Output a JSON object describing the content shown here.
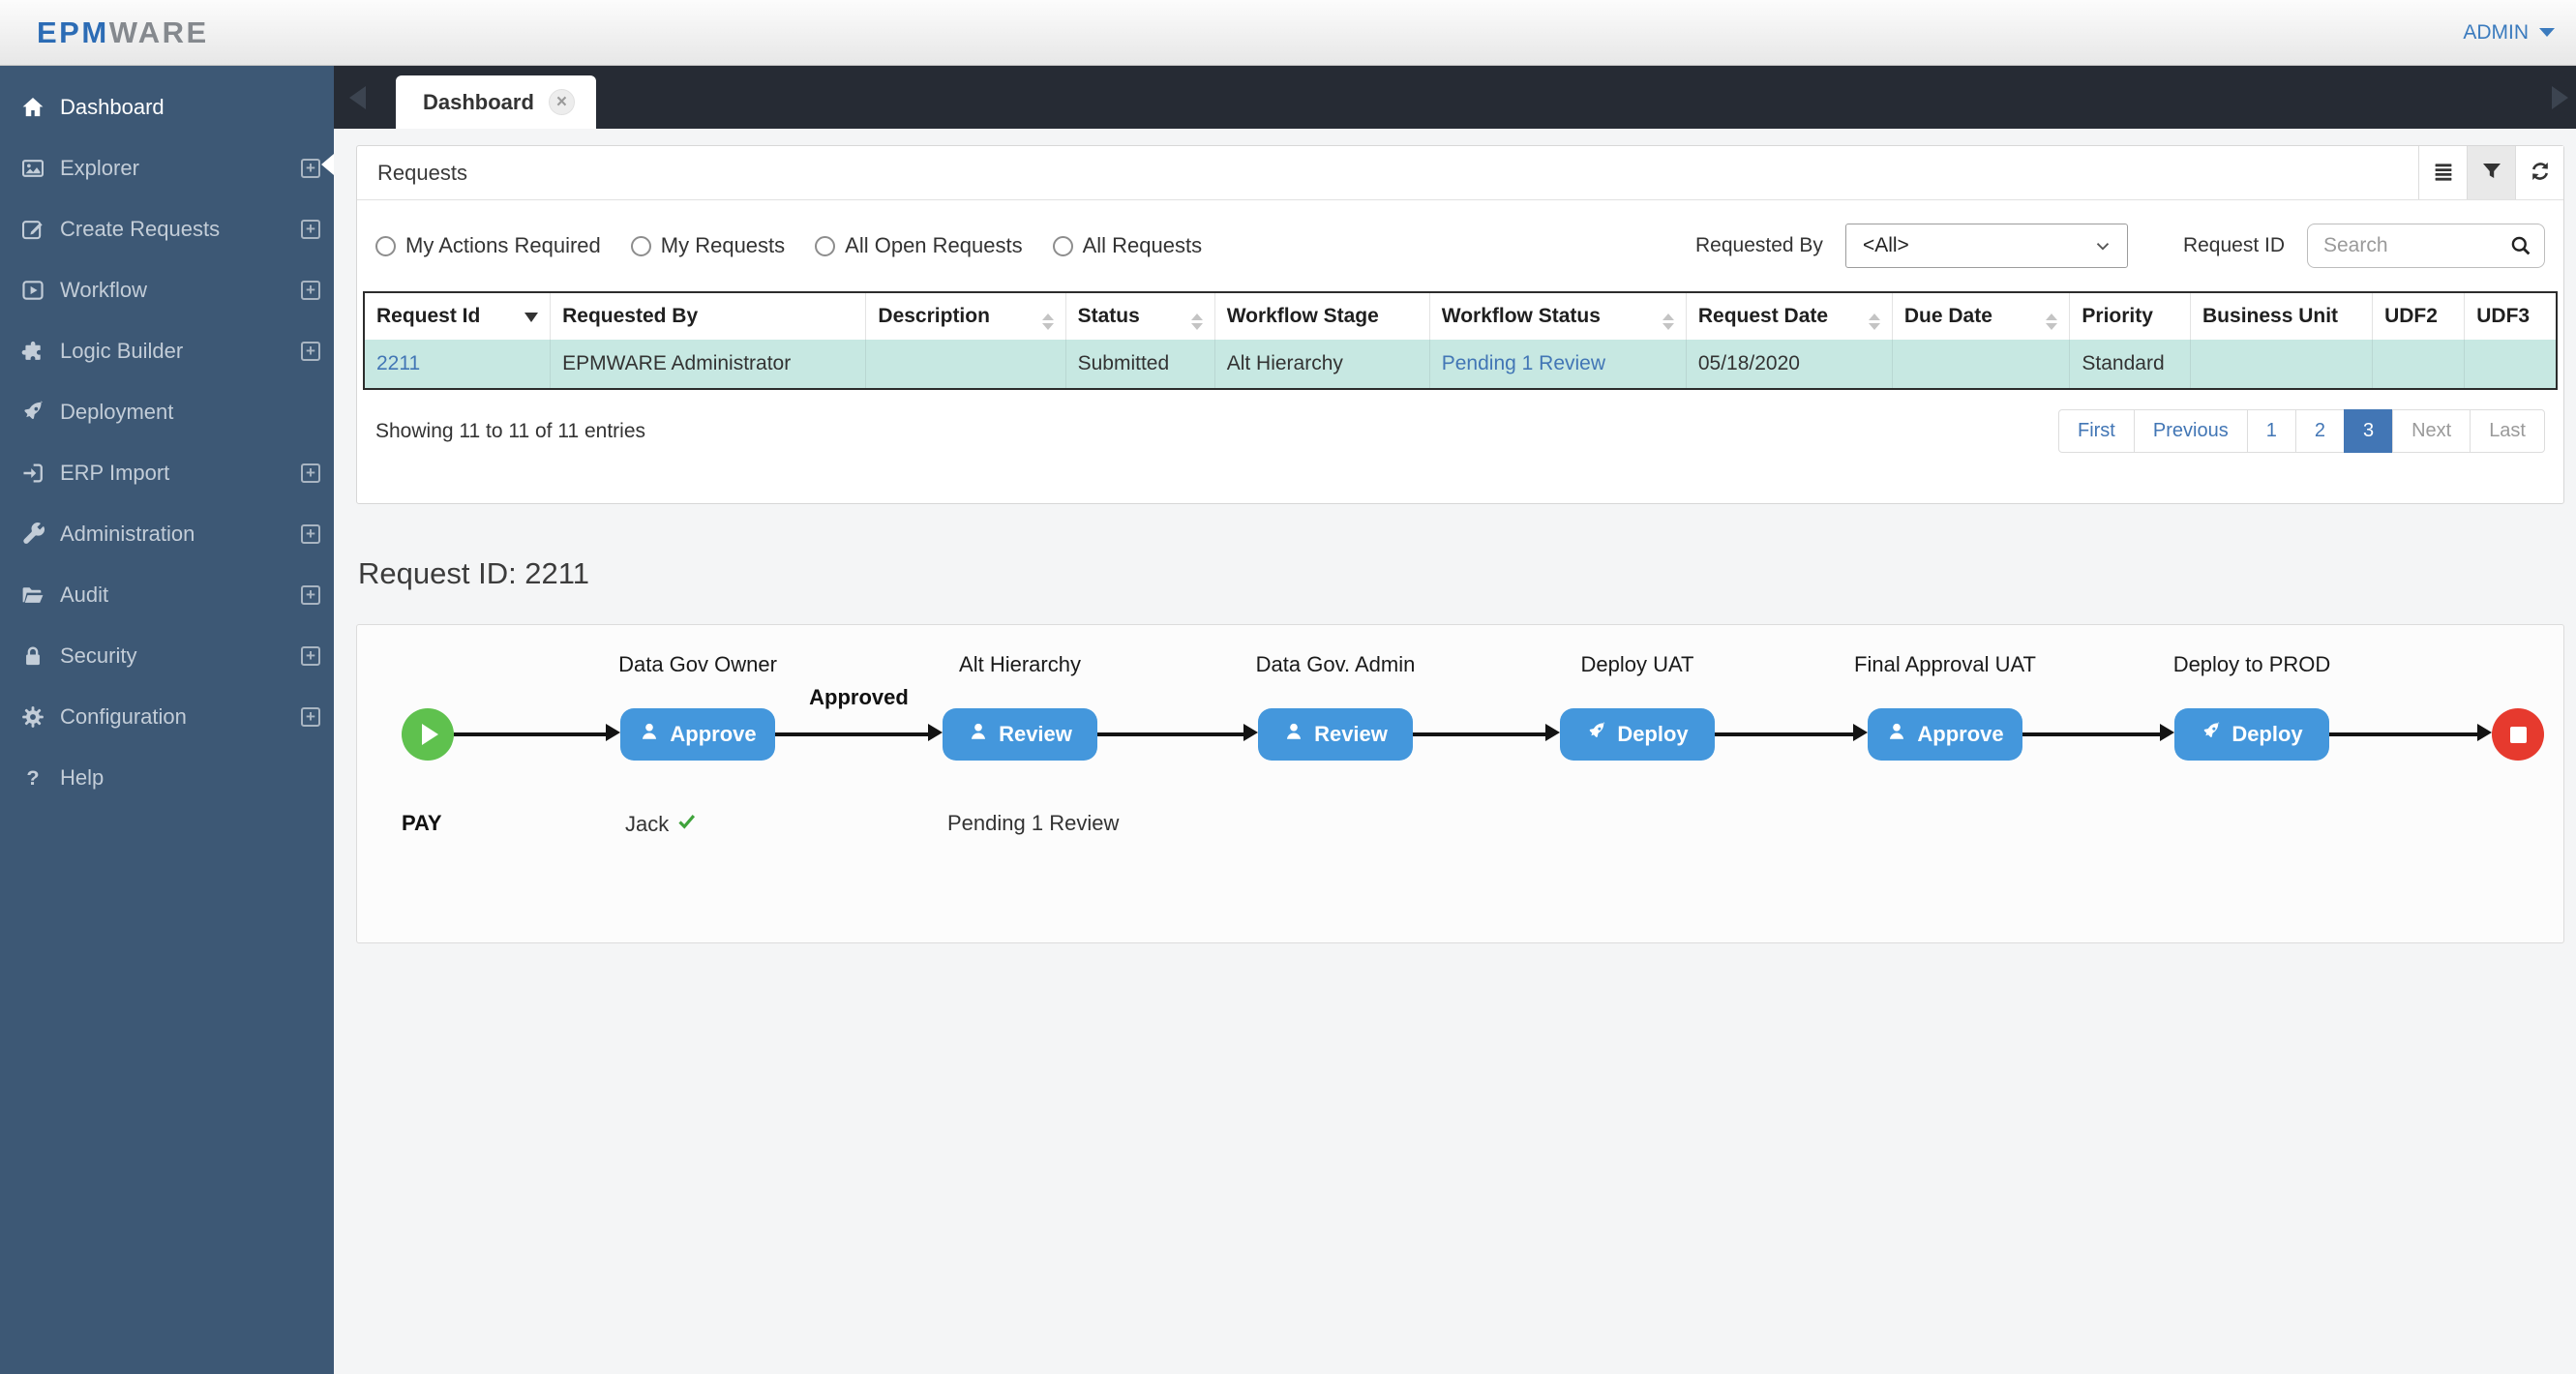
{
  "topbar": {
    "logo_primary": "EPM",
    "logo_secondary": "WARE",
    "user_menu": "ADMIN"
  },
  "sidebar": {
    "items": [
      {
        "label": "Dashboard",
        "icon": "home-icon",
        "active": true,
        "expandable": false
      },
      {
        "label": "Explorer",
        "icon": "image-icon",
        "active": false,
        "expandable": true
      },
      {
        "label": "Create Requests",
        "icon": "edit-icon",
        "active": false,
        "expandable": true
      },
      {
        "label": "Workflow",
        "icon": "play-square-icon",
        "active": false,
        "expandable": true
      },
      {
        "label": "Logic Builder",
        "icon": "puzzle-icon",
        "active": false,
        "expandable": true
      },
      {
        "label": "Deployment",
        "icon": "rocket-icon",
        "active": false,
        "expandable": false
      },
      {
        "label": "ERP Import",
        "icon": "sign-in-icon",
        "active": false,
        "expandable": true
      },
      {
        "label": "Administration",
        "icon": "wrench-icon",
        "active": false,
        "expandable": true
      },
      {
        "label": "Audit",
        "icon": "folder-open-icon",
        "active": false,
        "expandable": true
      },
      {
        "label": "Security",
        "icon": "lock-icon",
        "active": false,
        "expandable": true
      },
      {
        "label": "Configuration",
        "icon": "gear-icon",
        "active": false,
        "expandable": true
      },
      {
        "label": "Help",
        "icon": "question-icon",
        "active": false,
        "expandable": false
      }
    ]
  },
  "tabbar": {
    "active_tab": "Dashboard"
  },
  "requests_panel": {
    "title": "Requests",
    "toolbar": [
      {
        "icon": "list-icon",
        "active": false
      },
      {
        "icon": "filter-icon",
        "active": true
      },
      {
        "icon": "refresh-icon",
        "active": false
      }
    ],
    "filters": {
      "radios": [
        {
          "label": "My Actions Required",
          "checked": false
        },
        {
          "label": "My Requests",
          "checked": false
        },
        {
          "label": "All Open Requests",
          "checked": false
        },
        {
          "label": "All Requests",
          "checked": false
        }
      ],
      "requested_by_label": "Requested By",
      "requested_by_value": "<All>",
      "request_id_label": "Request ID",
      "search_placeholder": "Search"
    },
    "table": {
      "columns": [
        {
          "label": "Request Id",
          "sort": "desc"
        },
        {
          "label": "Requested By",
          "sort": "none"
        },
        {
          "label": "Description",
          "sort": "both"
        },
        {
          "label": "Status",
          "sort": "both"
        },
        {
          "label": "Workflow Stage",
          "sort": "none"
        },
        {
          "label": "Workflow Status",
          "sort": "both"
        },
        {
          "label": "Request Date",
          "sort": "both"
        },
        {
          "label": "Due Date",
          "sort": "both"
        },
        {
          "label": "Priority",
          "sort": "none"
        },
        {
          "label": "Business Unit",
          "sort": "none"
        },
        {
          "label": "UDF2",
          "sort": "none"
        },
        {
          "label": "UDF3",
          "sort": "none"
        }
      ],
      "rows": [
        {
          "cells": [
            "2211",
            "EPMWARE Administrator",
            "",
            "Submitted",
            "Alt Hierarchy",
            "Pending 1 Review",
            "05/18/2020",
            "",
            "Standard",
            "",
            "",
            ""
          ],
          "link_cells": [
            0,
            5
          ],
          "highlighted": true
        }
      ]
    },
    "summary": "Showing 11 to 11 of 11 entries",
    "pagination": [
      {
        "label": "First",
        "state": "link"
      },
      {
        "label": "Previous",
        "state": "link"
      },
      {
        "label": "1",
        "state": "link"
      },
      {
        "label": "2",
        "state": "link"
      },
      {
        "label": "3",
        "state": "active"
      },
      {
        "label": "Next",
        "state": "disabled"
      },
      {
        "label": "Last",
        "state": "disabled"
      }
    ]
  },
  "detail": {
    "heading": "Request ID: 2211"
  },
  "workflow": {
    "start_label": "PAY",
    "stages": [
      {
        "title": "Data Gov Owner",
        "button": "Approve",
        "icon": "user-icon",
        "arrow_label": "",
        "status": "Jack",
        "status_check": true
      },
      {
        "title": "Alt Hierarchy",
        "button": "Review",
        "icon": "user-icon",
        "arrow_label": "Approved",
        "status": "Pending 1 Review",
        "status_check": false
      },
      {
        "title": "Data Gov. Admin",
        "button": "Review",
        "icon": "user-icon",
        "arrow_label": "",
        "status": "",
        "status_check": false
      },
      {
        "title": "Deploy UAT",
        "button": "Deploy",
        "icon": "deploy-rocket-icon",
        "arrow_label": "",
        "status": "",
        "status_check": false
      },
      {
        "title": "Final Approval UAT",
        "button": "Approve",
        "icon": "user-icon",
        "arrow_label": "",
        "status": "",
        "status_check": false
      },
      {
        "title": "Deploy to PROD",
        "button": "Deploy",
        "icon": "deploy-rocket-icon",
        "arrow_label": "",
        "status": "",
        "status_check": false
      }
    ],
    "colors": {
      "node_blue": "#4497dc",
      "start_green": "#5fc14e",
      "end_red": "#e63a2e",
      "accent": "#4276b5",
      "row_highlight": "#c7e8e2"
    }
  }
}
